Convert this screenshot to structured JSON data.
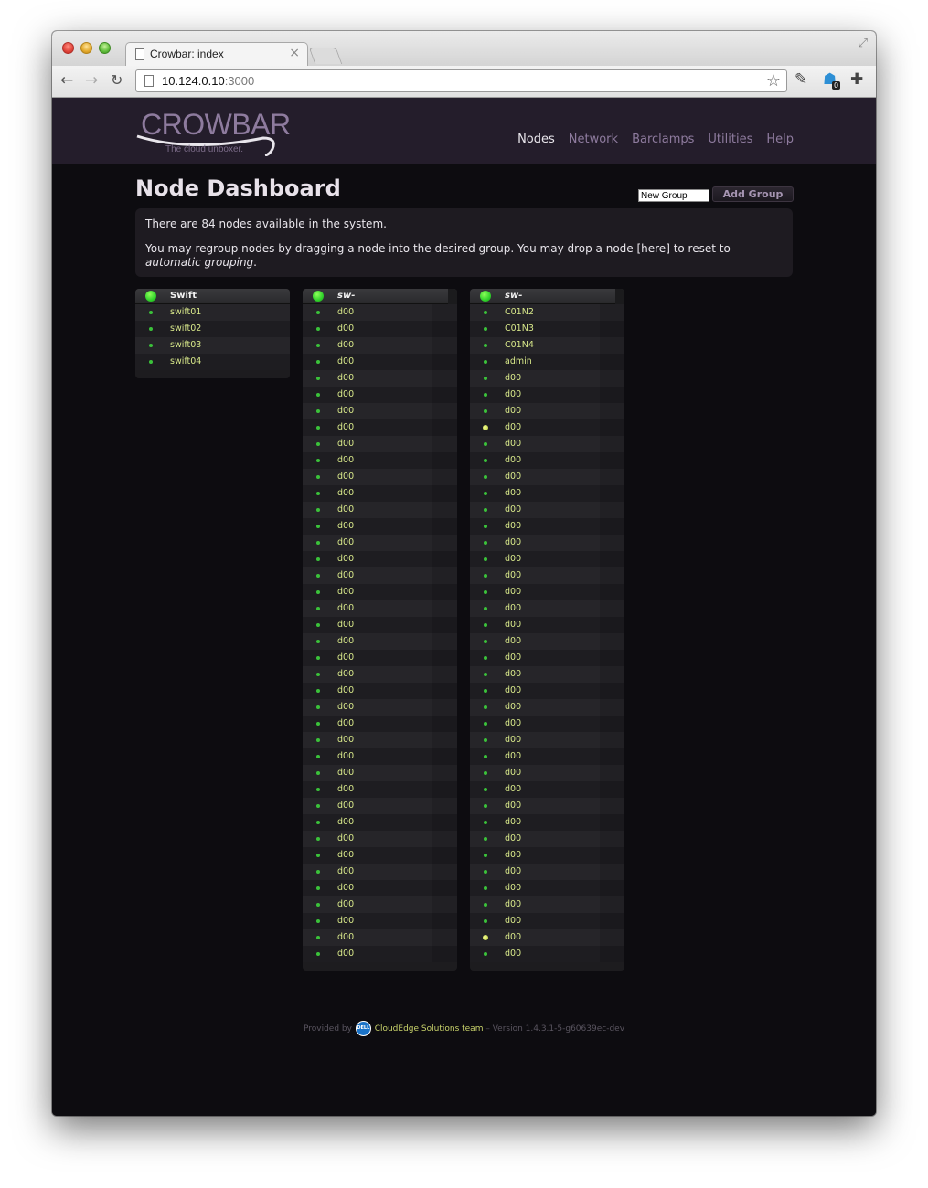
{
  "browser": {
    "tab_title": "Crowbar: index",
    "tab_close": "×",
    "url_host": "10.124.0.10",
    "url_port": ":3000",
    "ext_badge": "0"
  },
  "site": {
    "logo_word": "CROWBAR",
    "logo_tagline": "The cloud unboxer.",
    "nav": [
      "Nodes",
      "Network",
      "Barclamps",
      "Utilities",
      "Help"
    ],
    "nav_active": "Nodes"
  },
  "page": {
    "title": "Node Dashboard",
    "new_group_value": "New Group",
    "add_group_label": "Add Group",
    "info_line1": "There are 84 nodes available in the system.",
    "info_line2_a": "You may regroup nodes by dragging a node into the desired group. You may drop a node [here] to reset to ",
    "info_line2_em": "automatic grouping",
    "info_line2_end": "."
  },
  "groups": [
    {
      "name": "Swift",
      "italic": false,
      "nodes": [
        {
          "label": "swift01",
          "status": "ready"
        },
        {
          "label": "swift02",
          "status": "ready"
        },
        {
          "label": "swift03",
          "status": "ready"
        },
        {
          "label": "swift04",
          "status": "ready"
        }
      ]
    },
    {
      "name": "sw-",
      "italic": true,
      "nodes": [
        {
          "label": "d00",
          "status": "ready"
        },
        {
          "label": "d00",
          "status": "ready"
        },
        {
          "label": "d00",
          "status": "ready"
        },
        {
          "label": "d00",
          "status": "ready"
        },
        {
          "label": "d00",
          "status": "ready"
        },
        {
          "label": "d00",
          "status": "ready"
        },
        {
          "label": "d00",
          "status": "ready"
        },
        {
          "label": "d00",
          "status": "ready"
        },
        {
          "label": "d00",
          "status": "ready"
        },
        {
          "label": "d00",
          "status": "ready"
        },
        {
          "label": "d00",
          "status": "ready"
        },
        {
          "label": "d00",
          "status": "ready"
        },
        {
          "label": "d00",
          "status": "ready"
        },
        {
          "label": "d00",
          "status": "ready"
        },
        {
          "label": "d00",
          "status": "ready"
        },
        {
          "label": "d00",
          "status": "ready"
        },
        {
          "label": "d00",
          "status": "ready"
        },
        {
          "label": "d00",
          "status": "ready"
        },
        {
          "label": "d00",
          "status": "ready"
        },
        {
          "label": "d00",
          "status": "ready"
        },
        {
          "label": "d00",
          "status": "ready"
        },
        {
          "label": "d00",
          "status": "ready"
        },
        {
          "label": "d00",
          "status": "ready"
        },
        {
          "label": "d00",
          "status": "ready"
        },
        {
          "label": "d00",
          "status": "ready"
        },
        {
          "label": "d00",
          "status": "ready"
        },
        {
          "label": "d00",
          "status": "ready"
        },
        {
          "label": "d00",
          "status": "ready"
        },
        {
          "label": "d00",
          "status": "ready"
        },
        {
          "label": "d00",
          "status": "ready"
        },
        {
          "label": "d00",
          "status": "ready"
        },
        {
          "label": "d00",
          "status": "ready"
        },
        {
          "label": "d00",
          "status": "ready"
        },
        {
          "label": "d00",
          "status": "ready"
        },
        {
          "label": "d00",
          "status": "ready"
        },
        {
          "label": "d00",
          "status": "ready"
        },
        {
          "label": "d00",
          "status": "ready"
        },
        {
          "label": "d00",
          "status": "ready"
        },
        {
          "label": "d00",
          "status": "ready"
        },
        {
          "label": "d00",
          "status": "ready"
        }
      ]
    },
    {
      "name": "sw-",
      "italic": true,
      "nodes": [
        {
          "label": "C01N2",
          "status": "ready"
        },
        {
          "label": "C01N3",
          "status": "ready"
        },
        {
          "label": "C01N4",
          "status": "ready"
        },
        {
          "label": "admin",
          "status": "ready"
        },
        {
          "label": "d00",
          "status": "ready"
        },
        {
          "label": "d00",
          "status": "ready"
        },
        {
          "label": "d00",
          "status": "ready"
        },
        {
          "label": "d00",
          "status": "pending"
        },
        {
          "label": "d00",
          "status": "ready"
        },
        {
          "label": "d00",
          "status": "ready"
        },
        {
          "label": "d00",
          "status": "ready"
        },
        {
          "label": "d00",
          "status": "ready"
        },
        {
          "label": "d00",
          "status": "ready"
        },
        {
          "label": "d00",
          "status": "ready"
        },
        {
          "label": "d00",
          "status": "ready"
        },
        {
          "label": "d00",
          "status": "ready"
        },
        {
          "label": "d00",
          "status": "ready"
        },
        {
          "label": "d00",
          "status": "ready"
        },
        {
          "label": "d00",
          "status": "ready"
        },
        {
          "label": "d00",
          "status": "ready"
        },
        {
          "label": "d00",
          "status": "ready"
        },
        {
          "label": "d00",
          "status": "ready"
        },
        {
          "label": "d00",
          "status": "ready"
        },
        {
          "label": "d00",
          "status": "ready"
        },
        {
          "label": "d00",
          "status": "ready"
        },
        {
          "label": "d00",
          "status": "ready"
        },
        {
          "label": "d00",
          "status": "ready"
        },
        {
          "label": "d00",
          "status": "ready"
        },
        {
          "label": "d00",
          "status": "ready"
        },
        {
          "label": "d00",
          "status": "ready"
        },
        {
          "label": "d00",
          "status": "ready"
        },
        {
          "label": "d00",
          "status": "ready"
        },
        {
          "label": "d00",
          "status": "ready"
        },
        {
          "label": "d00",
          "status": "ready"
        },
        {
          "label": "d00",
          "status": "ready"
        },
        {
          "label": "d00",
          "status": "ready"
        },
        {
          "label": "d00",
          "status": "ready"
        },
        {
          "label": "d00",
          "status": "ready"
        },
        {
          "label": "d00",
          "status": "pending"
        },
        {
          "label": "d00",
          "status": "ready"
        }
      ]
    }
  ],
  "footer": {
    "provided_by": "Provided by",
    "dell": "DELL",
    "team": "CloudEdge Solutions team",
    "version": "– Version 1.4.3.1-5-g60639ec-dev"
  },
  "colors": {
    "accent_purple": "#8e7b9e",
    "node_label": "#d8e88a",
    "status_ready": "#3bc23a",
    "status_pending": "#e6f07a"
  }
}
